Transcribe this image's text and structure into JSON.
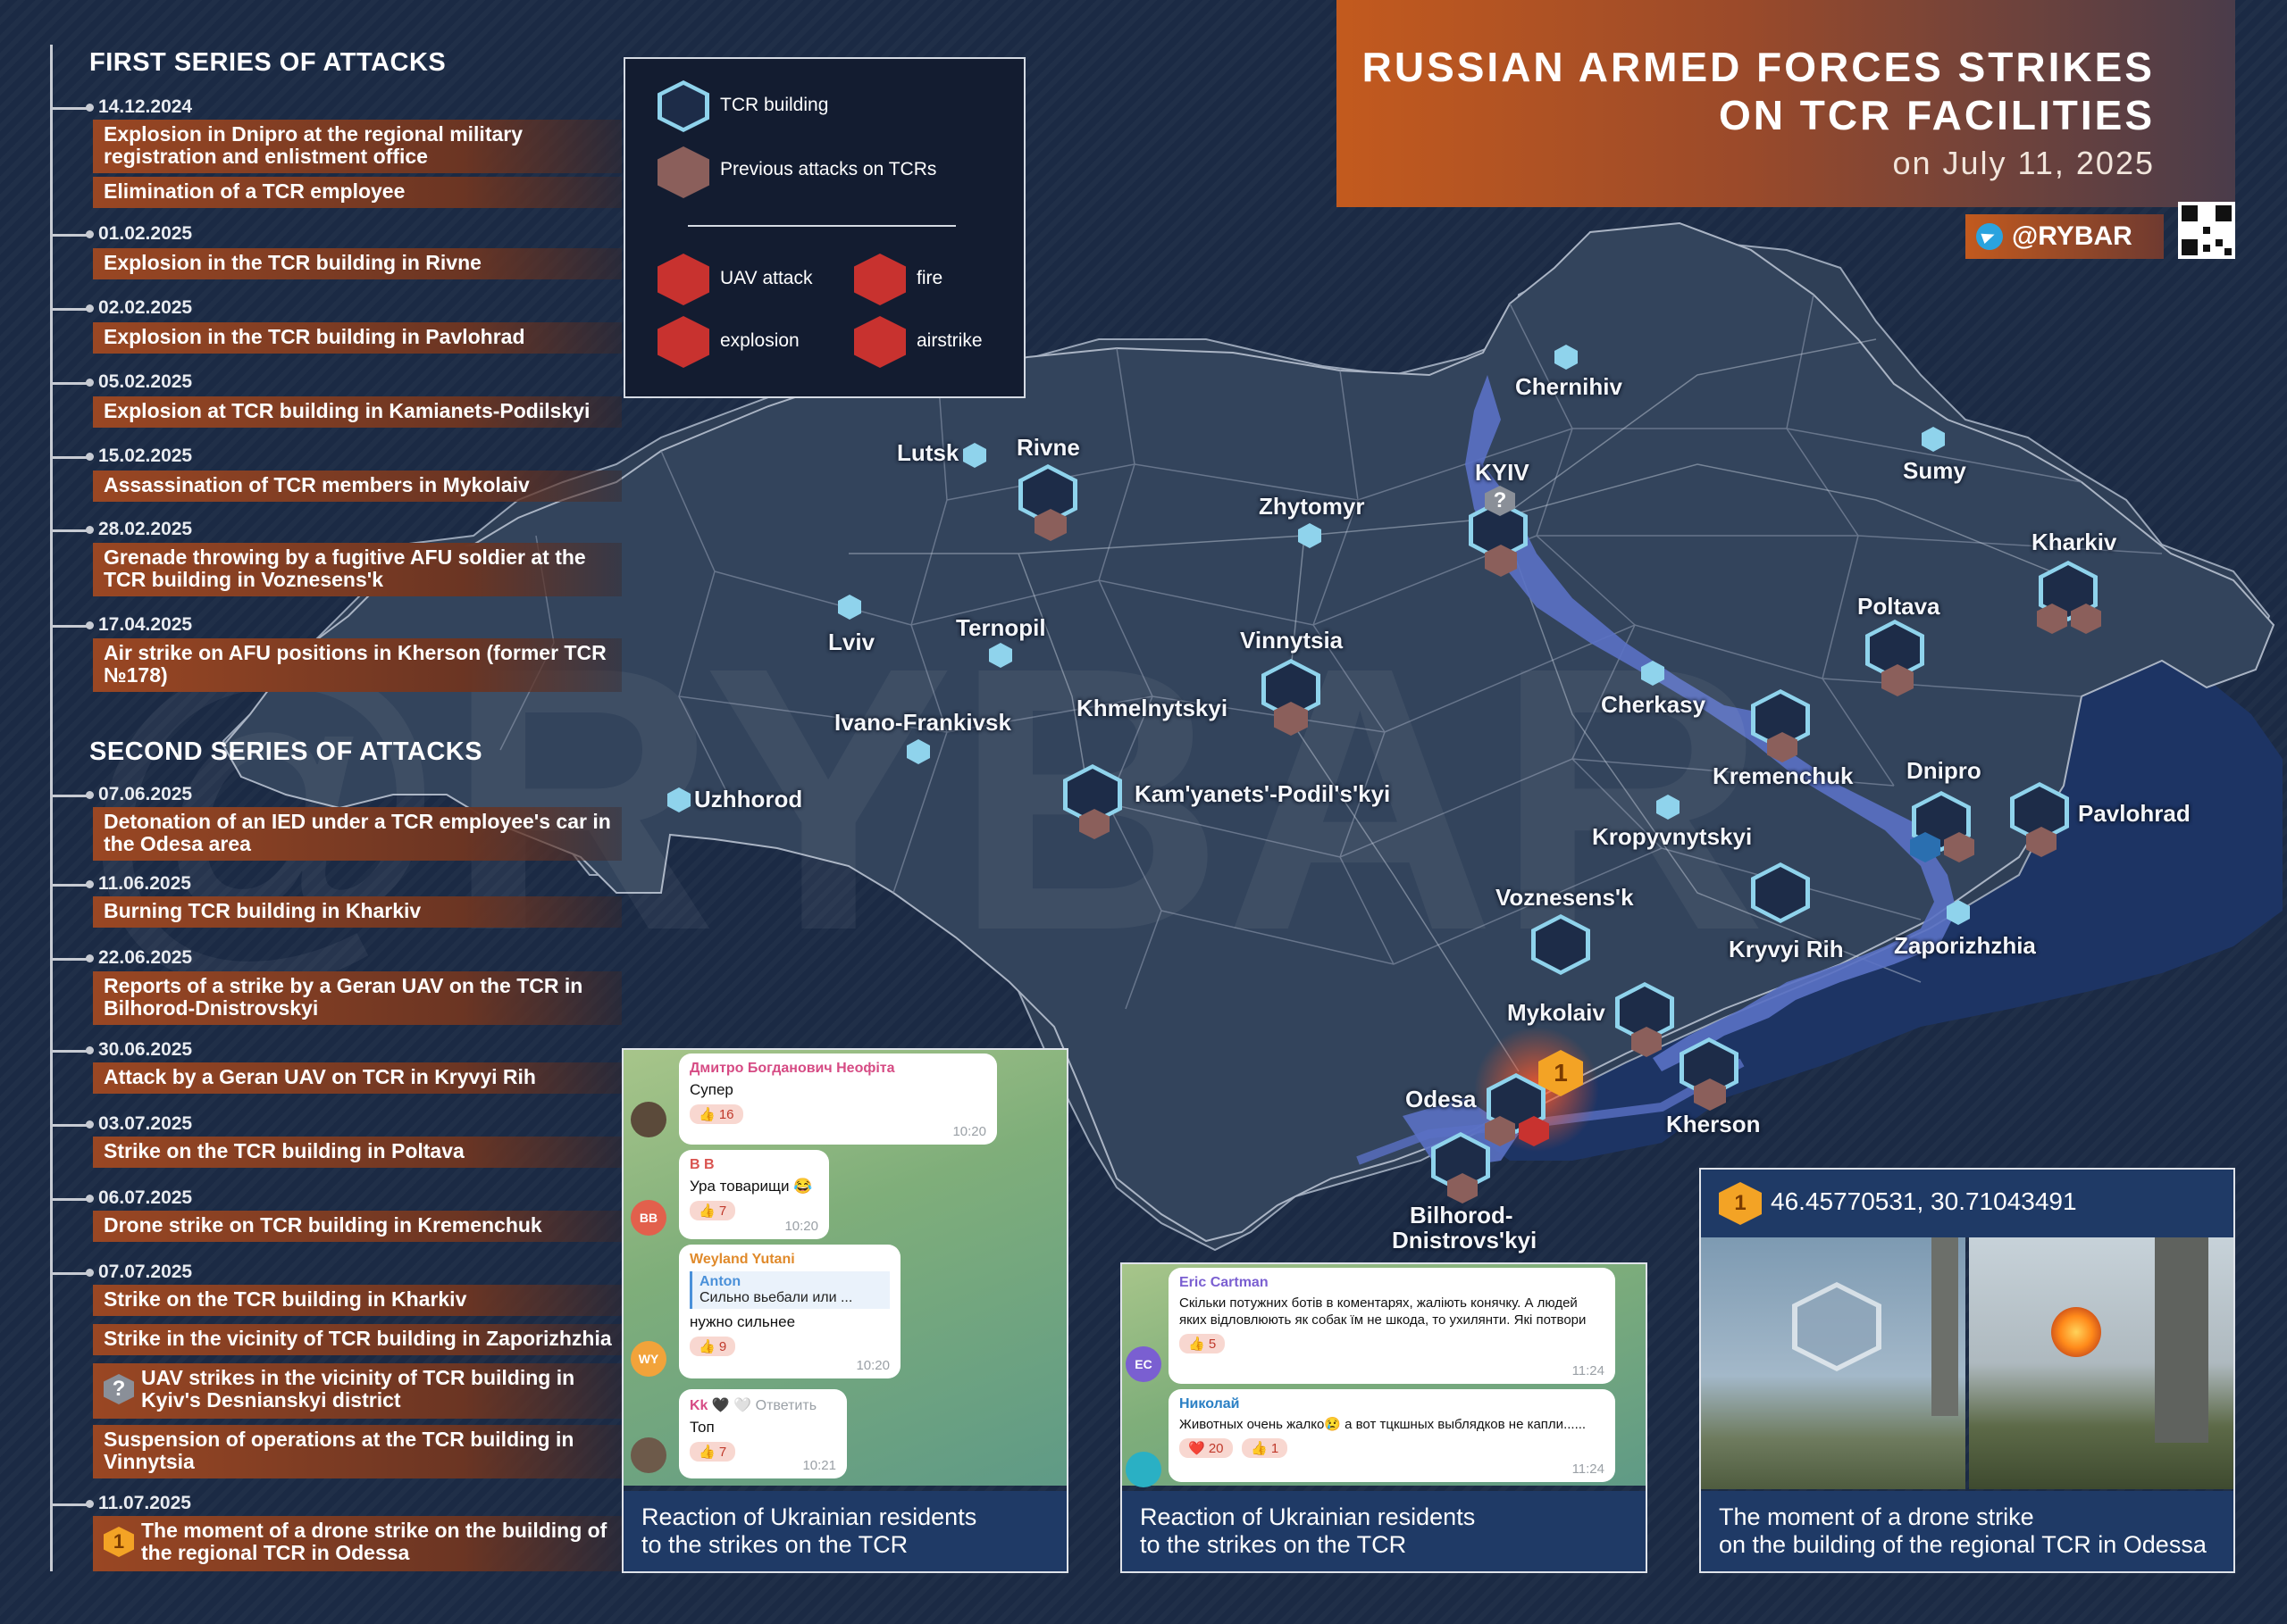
{
  "header": {
    "title_line1": "RUSSIAN ARMED FORCES STRIKES",
    "title_line2": "ON TCR FACILITIES",
    "subtitle": "on July 11, 2025",
    "handle": "@RYBAR"
  },
  "legend": {
    "tcr_building": "TCR building",
    "previous_attacks": "Previous attacks on TCRs",
    "uav_attack": "UAV attack",
    "fire": "fire",
    "explosion": "explosion",
    "airstrike": "airstrike"
  },
  "timeline": {
    "first_series_title": "FIRST SERIES OF ATTACKS",
    "second_series_title": "SECOND SERIES OF ATTACKS",
    "first": [
      {
        "date": "14.12.2024",
        "events": [
          "Explosion in Dnipro at the regional military registration and enlistment office",
          "Elimination of a TCR employee"
        ]
      },
      {
        "date": "01.02.2025",
        "events": [
          "Explosion in the TCR building in Rivne"
        ]
      },
      {
        "date": "02.02.2025",
        "events": [
          "Explosion in the TCR building in Pavlohrad"
        ]
      },
      {
        "date": "05.02.2025",
        "events": [
          "Explosion at TCR building in Kamianets-Podilskyi"
        ]
      },
      {
        "date": "15.02.2025",
        "events": [
          "Assassination of TCR members in Mykolaiv"
        ]
      },
      {
        "date": "28.02.2025",
        "events": [
          "Grenade throwing by a fugitive AFU soldier at the TCR building in Voznesens'k"
        ]
      },
      {
        "date": "17.04.2025",
        "events": [
          "Air strike on AFU positions in Kherson (former TCR №178)"
        ]
      }
    ],
    "second": [
      {
        "date": "07.06.2025",
        "events": [
          "Detonation of an IED under a TCR employee's car in the Odesa area"
        ]
      },
      {
        "date": "11.06.2025",
        "events": [
          "Burning TCR building in Kharkiv"
        ]
      },
      {
        "date": "22.06.2025",
        "events": [
          "Reports of a strike by a Geran UAV on the TCR in Bilhorod-Dnistrovskyi"
        ]
      },
      {
        "date": "30.06.2025",
        "events": [
          "Attack by a Geran UAV on TCR in Kryvyi Rih"
        ]
      },
      {
        "date": "03.07.2025",
        "events": [
          "Strike on the TCR building in Poltava"
        ]
      },
      {
        "date": "06.07.2025",
        "events": [
          "Drone strike on TCR building in Kremenchuk"
        ]
      },
      {
        "date": "07.07.2025",
        "events": [
          "Strike on the TCR building in Kharkiv",
          "Strike in the vicinity of TCR building in Zaporizhzhia",
          "UAV strikes in the vicinity of TCR building in Kyiv's Desnianskyi district",
          "Suspension of operations at the TCR building in Vinnytsia"
        ]
      },
      {
        "date": "11.07.2025",
        "events": [
          "The moment of a drone strike on the building of the regional TCR in Odessa"
        ]
      }
    ],
    "question_badge": "?",
    "one_badge": "1"
  },
  "cities": {
    "chernihiv": "Chernihiv",
    "lutsk": "Lutsk",
    "rivne": "Rivne",
    "kyiv": "KYIV",
    "sumy": "Sumy",
    "zhytomyr": "Zhytomyr",
    "kharkiv": "Kharkiv",
    "lviv": "Lviv",
    "ternopil": "Ternopil",
    "vinnytsia": "Vinnytsia",
    "poltava": "Poltava",
    "khmelnytskyi": "Khmelnytskyi",
    "cherkasy": "Cherkasy",
    "ivano_frankivsk": "Ivano-Frankivsk",
    "kremenchuk": "Kremenchuk",
    "dnipro": "Dnipro",
    "uzhhorod": "Uzhhorod",
    "kamyanets": "Kam'yanets'-Podil's'kyi",
    "pavlohrad": "Pavlohrad",
    "kropyvnytskyi": "Kropyvnytskyi",
    "voznesensk": "Voznesens'k",
    "kryvyi_rih": "Kryvyi Rih",
    "zaporizhzhia": "Zaporizhzhia",
    "mykolaiv": "Mykolaiv",
    "odesa": "Odesa",
    "kherson": "Kherson",
    "bilhorod_1": "Bilhorod-",
    "bilhorod_2": "Dnistrovs'kyi"
  },
  "map_markers": {
    "kyiv_question": "?",
    "odesa_number": "1"
  },
  "panels": {
    "chat1": {
      "caption_line1": "Reaction of Ukrainian residents",
      "caption_line2": "to the strikes on the TCR",
      "messages": [
        {
          "name": "Дмитро Богданович Неофіта",
          "text": "Супер",
          "reaction": "👍 16",
          "time": "10:20"
        },
        {
          "name": "B B",
          "text": "Ура товарищи 😂",
          "reaction": "👍 7",
          "time": "10:20",
          "avatar": "BB"
        },
        {
          "name": "Weyland Yutani",
          "quote_name": "Anton",
          "quote_text": "Сильно вьебали или ...",
          "text": "нужно сильнее",
          "reaction": "👍 9",
          "time": "10:20",
          "avatar": "WY"
        },
        {
          "name": "Kk 🖤 🤍",
          "reply": "Ответить",
          "text": "Топ",
          "reaction": "👍 7",
          "time": "10:21"
        }
      ]
    },
    "chat2": {
      "caption_line1": "Reaction of Ukrainian residents",
      "caption_line2": "to the strikes on the TCR",
      "messages": [
        {
          "name": "Eric Cartman",
          "text": "Скільки потужних ботів в коментарях, жаліють конячку. А людей яких відловлюють як собак їм не шкода, то ухилянти. Які потвори",
          "reaction": "👍 5",
          "time": "11:24",
          "avatar": "EC"
        },
        {
          "name": "Николай",
          "text": "Животных очень жалко😢 а вот тцкшных выблядков не капли......",
          "reaction1": "❤️ 20",
          "reaction2": "👍 1",
          "time": "11:24"
        }
      ]
    },
    "video": {
      "coords": "46.45770531, 30.71043491",
      "badge": "1",
      "caption_line1": "The moment of a drone strike",
      "caption_line2": "on the building of the regional TCR in Odessa"
    }
  },
  "colors": {
    "accent_orange": "#c35a1e",
    "panel_blue": "#1f3a66",
    "map_land": "#2f3f56",
    "map_occupied": "#1d3566",
    "river": "#5a71c4",
    "tcr_hex": "#8fd3ec",
    "previous_attack": "#8b5f5b",
    "attack_red": "#c8322f"
  }
}
